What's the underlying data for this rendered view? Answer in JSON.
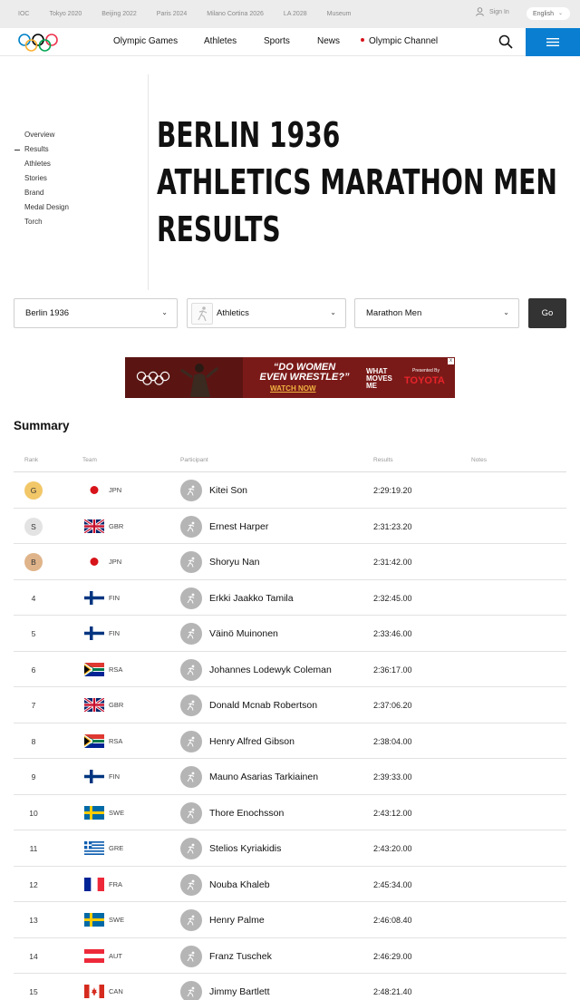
{
  "topbar": {
    "links": [
      "IOC",
      "Tokyo 2020",
      "Beijing 2022",
      "Paris 2024",
      "Milano Cortina 2026",
      "LA 2028",
      "Museum"
    ],
    "signin": "Sign In",
    "language": "English"
  },
  "nav": {
    "items": [
      "Olympic Games",
      "Athletes",
      "Sports",
      "News",
      "Olympic Channel"
    ]
  },
  "sidebar": {
    "items": [
      "Overview",
      "Results",
      "Athletes",
      "Stories",
      "Brand",
      "Medal Design",
      "Torch"
    ],
    "active": "Results"
  },
  "title": {
    "line1": "BERLIN 1936",
    "line2": "ATHLETICS MARATHON MEN",
    "line3": "RESULTS"
  },
  "filters": {
    "games": "Berlin 1936",
    "sport": "Athletics",
    "event": "Marathon Men",
    "go": "Go"
  },
  "ad": {
    "headline_1": "“DO WOMEN",
    "headline_2": "EVEN WRESTLE?”",
    "cta": "WATCH NOW",
    "wmm_1": "WHAT",
    "wmm_2": "MOVES",
    "wmm_3": "ME",
    "presented": "Presented By",
    "sponsor": "TOYOTA",
    "close": "x"
  },
  "summary_heading": "Summary",
  "table": {
    "headers": {
      "rank": "Rank",
      "team": "Team",
      "participant": "Participant",
      "results": "Results",
      "notes": "Notes"
    },
    "rows": [
      {
        "rank": "G",
        "medal": "gold",
        "code": "JPN",
        "flag": "jpn",
        "name": "Kitei Son",
        "result": "2:29:19.20"
      },
      {
        "rank": "S",
        "medal": "silver",
        "code": "GBR",
        "flag": "gbr",
        "name": "Ernest Harper",
        "result": "2:31:23.20"
      },
      {
        "rank": "B",
        "medal": "bronze",
        "code": "JPN",
        "flag": "jpn",
        "name": "Shoryu Nan",
        "result": "2:31:42.00"
      },
      {
        "rank": "4",
        "medal": "",
        "code": "FIN",
        "flag": "fin",
        "name": "Erkki Jaakko Tamila",
        "result": "2:32:45.00"
      },
      {
        "rank": "5",
        "medal": "",
        "code": "FIN",
        "flag": "fin",
        "name": "Väinö Muinonen",
        "result": "2:33:46.00"
      },
      {
        "rank": "6",
        "medal": "",
        "code": "RSA",
        "flag": "rsa",
        "name": "Johannes Lodewyk Coleman",
        "result": "2:36:17.00"
      },
      {
        "rank": "7",
        "medal": "",
        "code": "GBR",
        "flag": "gbr",
        "name": "Donald Mcnab Robertson",
        "result": "2:37:06.20"
      },
      {
        "rank": "8",
        "medal": "",
        "code": "RSA",
        "flag": "rsa",
        "name": "Henry Alfred Gibson",
        "result": "2:38:04.00"
      },
      {
        "rank": "9",
        "medal": "",
        "code": "FIN",
        "flag": "fin",
        "name": "Mauno Asarias Tarkiainen",
        "result": "2:39:33.00"
      },
      {
        "rank": "10",
        "medal": "",
        "code": "SWE",
        "flag": "swe",
        "name": "Thore Enochsson",
        "result": "2:43:12.00"
      },
      {
        "rank": "11",
        "medal": "",
        "code": "GRE",
        "flag": "gre",
        "name": "Stelios Kyriakidis",
        "result": "2:43:20.00"
      },
      {
        "rank": "12",
        "medal": "",
        "code": "FRA",
        "flag": "fra",
        "name": "Nouba Khaleb",
        "result": "2:45:34.00"
      },
      {
        "rank": "13",
        "medal": "",
        "code": "SWE",
        "flag": "swe",
        "name": "Henry Palme",
        "result": "2:46:08.40"
      },
      {
        "rank": "14",
        "medal": "",
        "code": "AUT",
        "flag": "aut",
        "name": "Franz Tuschek",
        "result": "2:46:29.00"
      },
      {
        "rank": "15",
        "medal": "",
        "code": "CAN",
        "flag": "can",
        "name": "Jimmy Bartlett",
        "result": "2:48:21.40"
      }
    ]
  },
  "colors": {
    "gold": "#f2c768",
    "silver": "#e3e3e3",
    "bronze": "#e0b48a",
    "nav_menu": "#0a7fd1",
    "go_button": "#333333"
  }
}
